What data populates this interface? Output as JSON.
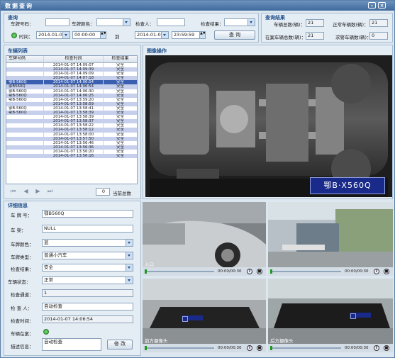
{
  "window": {
    "title": "数据查询"
  },
  "query": {
    "group_title": "查询",
    "plate_label": "车牌号码：",
    "plate_value": "",
    "color_label": "车牌颜色：",
    "color_value": "",
    "inspector_label": "检查人：",
    "inspector_value": "",
    "result_label": "检查结果：",
    "result_value": "",
    "time_label": "时间：",
    "start_date": "2014-01-07",
    "start_time": "00:00:00",
    "to_label": "到",
    "end_date": "2014-01-07",
    "end_time": "23:59:59",
    "search_button": "查  询"
  },
  "stats": {
    "group_title": "查询结果",
    "total_label": "车辆总数(辆)：",
    "total_value": "21",
    "normal_label": "正常车辆数(辆)：",
    "normal_value": "21",
    "blacklist_label": "在案车辆总数(辆)：",
    "blacklist_value": "21",
    "wanted_label": "求警车辆数(辆)：",
    "wanted_value": "0"
  },
  "list": {
    "group_title": "车辆列表",
    "columns": [
      "车牌号码",
      "检查时间",
      "检查结果"
    ],
    "rows": [
      {
        "plate": "",
        "time": "2014-01-07 14:09:07",
        "result": "安全"
      },
      {
        "plate": "",
        "time": "2014-01-07 14:09:39",
        "result": "安全"
      },
      {
        "plate": "",
        "time": "2014-01-07 14:09:09",
        "result": "安全"
      },
      {
        "plate": "",
        "time": "2014-01-07 14:07:18",
        "result": "安全"
      },
      {
        "plate": "鄂B-560Q",
        "time": "2014-01-07 14:06:54",
        "result": "安全"
      },
      {
        "plate": "鄂B560Q",
        "time": "2014-01-07 14:06:54",
        "result": "安全"
      },
      {
        "plate": "鄂B-560Q",
        "time": "2014-01-07 14:06:30",
        "result": "安全"
      },
      {
        "plate": "鄂B-560Q",
        "time": "2014-01-07 14:06:25",
        "result": "安全"
      },
      {
        "plate": "鄂B-560Q",
        "time": "2014-01-07 13:59:20",
        "result": "安全"
      },
      {
        "plate": "",
        "time": "2014-01-07 13:58:59",
        "result": "安全"
      },
      {
        "plate": "鄂B-560Q",
        "time": "2014-01-07 13:58:41",
        "result": "安全"
      },
      {
        "plate": "鄂B-560Q",
        "time": "2014-01-07 13:58:39",
        "result": "安全"
      },
      {
        "plate": "",
        "time": "2014-01-07 13:58:39",
        "result": "安全"
      },
      {
        "plate": "",
        "time": "2014-01-07 13:58:37",
        "result": "安全"
      },
      {
        "plate": "",
        "time": "2014-01-07 13:58:22",
        "result": "安全"
      },
      {
        "plate": "",
        "time": "2014-01-07 13:58:12",
        "result": "安全"
      },
      {
        "plate": "",
        "time": "2014-01-07 13:58:00",
        "result": "安全"
      },
      {
        "plate": "",
        "time": "2014-01-07 13:57:50",
        "result": "安全"
      },
      {
        "plate": "",
        "time": "2014-01-07 13:56:46",
        "result": "安全"
      },
      {
        "plate": "",
        "time": "2014-01-07 13:56:36",
        "result": "安全"
      },
      {
        "plate": "",
        "time": "2014-01-07 13:56:20",
        "result": "安全"
      },
      {
        "plate": "",
        "time": "2014-01-07 13:56:16",
        "result": "安全"
      }
    ],
    "page_value": "0",
    "page_label": "当前总数"
  },
  "image": {
    "group_title": "图像操作",
    "plate_text": "鄂B·X560Q"
  },
  "details": {
    "group_title": "详细信息",
    "plate_label": "车  牌  号：",
    "plate_value": "鄂B560Q",
    "vin_label": "车      架：",
    "vin_value": "NULL",
    "color_label": "车牌颜色：",
    "color_value": "蓝",
    "type_label": "车牌类型：",
    "type_value": "普通小汽车",
    "result_label": "检查结果：",
    "result_value": "安全",
    "status_label": "车辆状态：",
    "status_value": "正常",
    "lane_label": "检查通道：",
    "lane_value": "1",
    "inspector_label": "检  查  人：",
    "inspector_value": "自动检查",
    "time_label": "检查时间：",
    "time_value": "2014-01-07 14:06:54",
    "online_label": "车辆在案：",
    "note_label": "描述信息：",
    "note_value": "自动检查",
    "modify_button": "修 改"
  },
  "videos": [
    {
      "label": "入口",
      "time": "00:00/00:30"
    },
    {
      "label": "",
      "time": "00:00/00:30"
    },
    {
      "label": "前方摄像头",
      "time": "00:00/00:30"
    },
    {
      "label": "后方摄像头",
      "time": "00:00/00:30"
    }
  ]
}
